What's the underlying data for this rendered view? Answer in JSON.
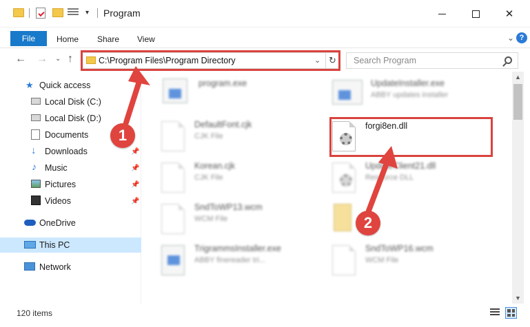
{
  "titlebar": {
    "title": "Program",
    "minimize_icon": "minimize-icon",
    "maximize_icon": "maximize-icon",
    "close_icon": "close-icon"
  },
  "ribbon": {
    "tabs": [
      "File",
      "Home",
      "Share",
      "View"
    ],
    "accent": "#1979ca"
  },
  "navigation": {
    "address": "C:\\Program Files\\Program Directory",
    "search_placeholder": "Search Program"
  },
  "sidebar": {
    "items": [
      {
        "label": "Quick access",
        "icon": "star-icon"
      },
      {
        "label": "Local Disk (C:)",
        "icon": "drive-icon"
      },
      {
        "label": "Local Disk (D:)",
        "icon": "drive-icon"
      },
      {
        "label": "Documents",
        "icon": "documents-icon"
      },
      {
        "label": "Downloads",
        "icon": "download-icon"
      },
      {
        "label": "Music",
        "icon": "music-icon"
      },
      {
        "label": "Pictures",
        "icon": "pictures-icon"
      },
      {
        "label": "Videos",
        "icon": "videos-icon"
      },
      {
        "label": "OneDrive",
        "icon": "cloud-icon"
      },
      {
        "label": "This PC",
        "icon": "computer-icon"
      },
      {
        "label": "Network",
        "icon": "network-icon"
      }
    ],
    "selected": "This PC"
  },
  "files": {
    "left": [
      {
        "name": "program.exe",
        "desc": ""
      },
      {
        "name": "DefaultFont.cjk",
        "desc": "CJK File"
      },
      {
        "name": "Korean.cjk",
        "desc": "CJK File"
      },
      {
        "name": "SndToWP13.wcm",
        "desc": "WCM File"
      },
      {
        "name": "TrigrammsInstaller.exe",
        "desc": "ABBY finereader tri..."
      }
    ],
    "right": [
      {
        "name": "UpdateInstaller.exe",
        "desc": "ABBY updates installer"
      },
      {
        "name": "forgi8en.dll",
        "desc": ""
      },
      {
        "name": "UpdateClient21.dll",
        "desc": "Resource DLL"
      },
      {
        "name": "",
        "desc": ""
      },
      {
        "name": "SndToWP16.wcm",
        "desc": "WCM File"
      }
    ]
  },
  "status": {
    "item_count": "120 items"
  },
  "annotations": {
    "step1": "1",
    "step2": "2",
    "color": "#e0443e"
  }
}
